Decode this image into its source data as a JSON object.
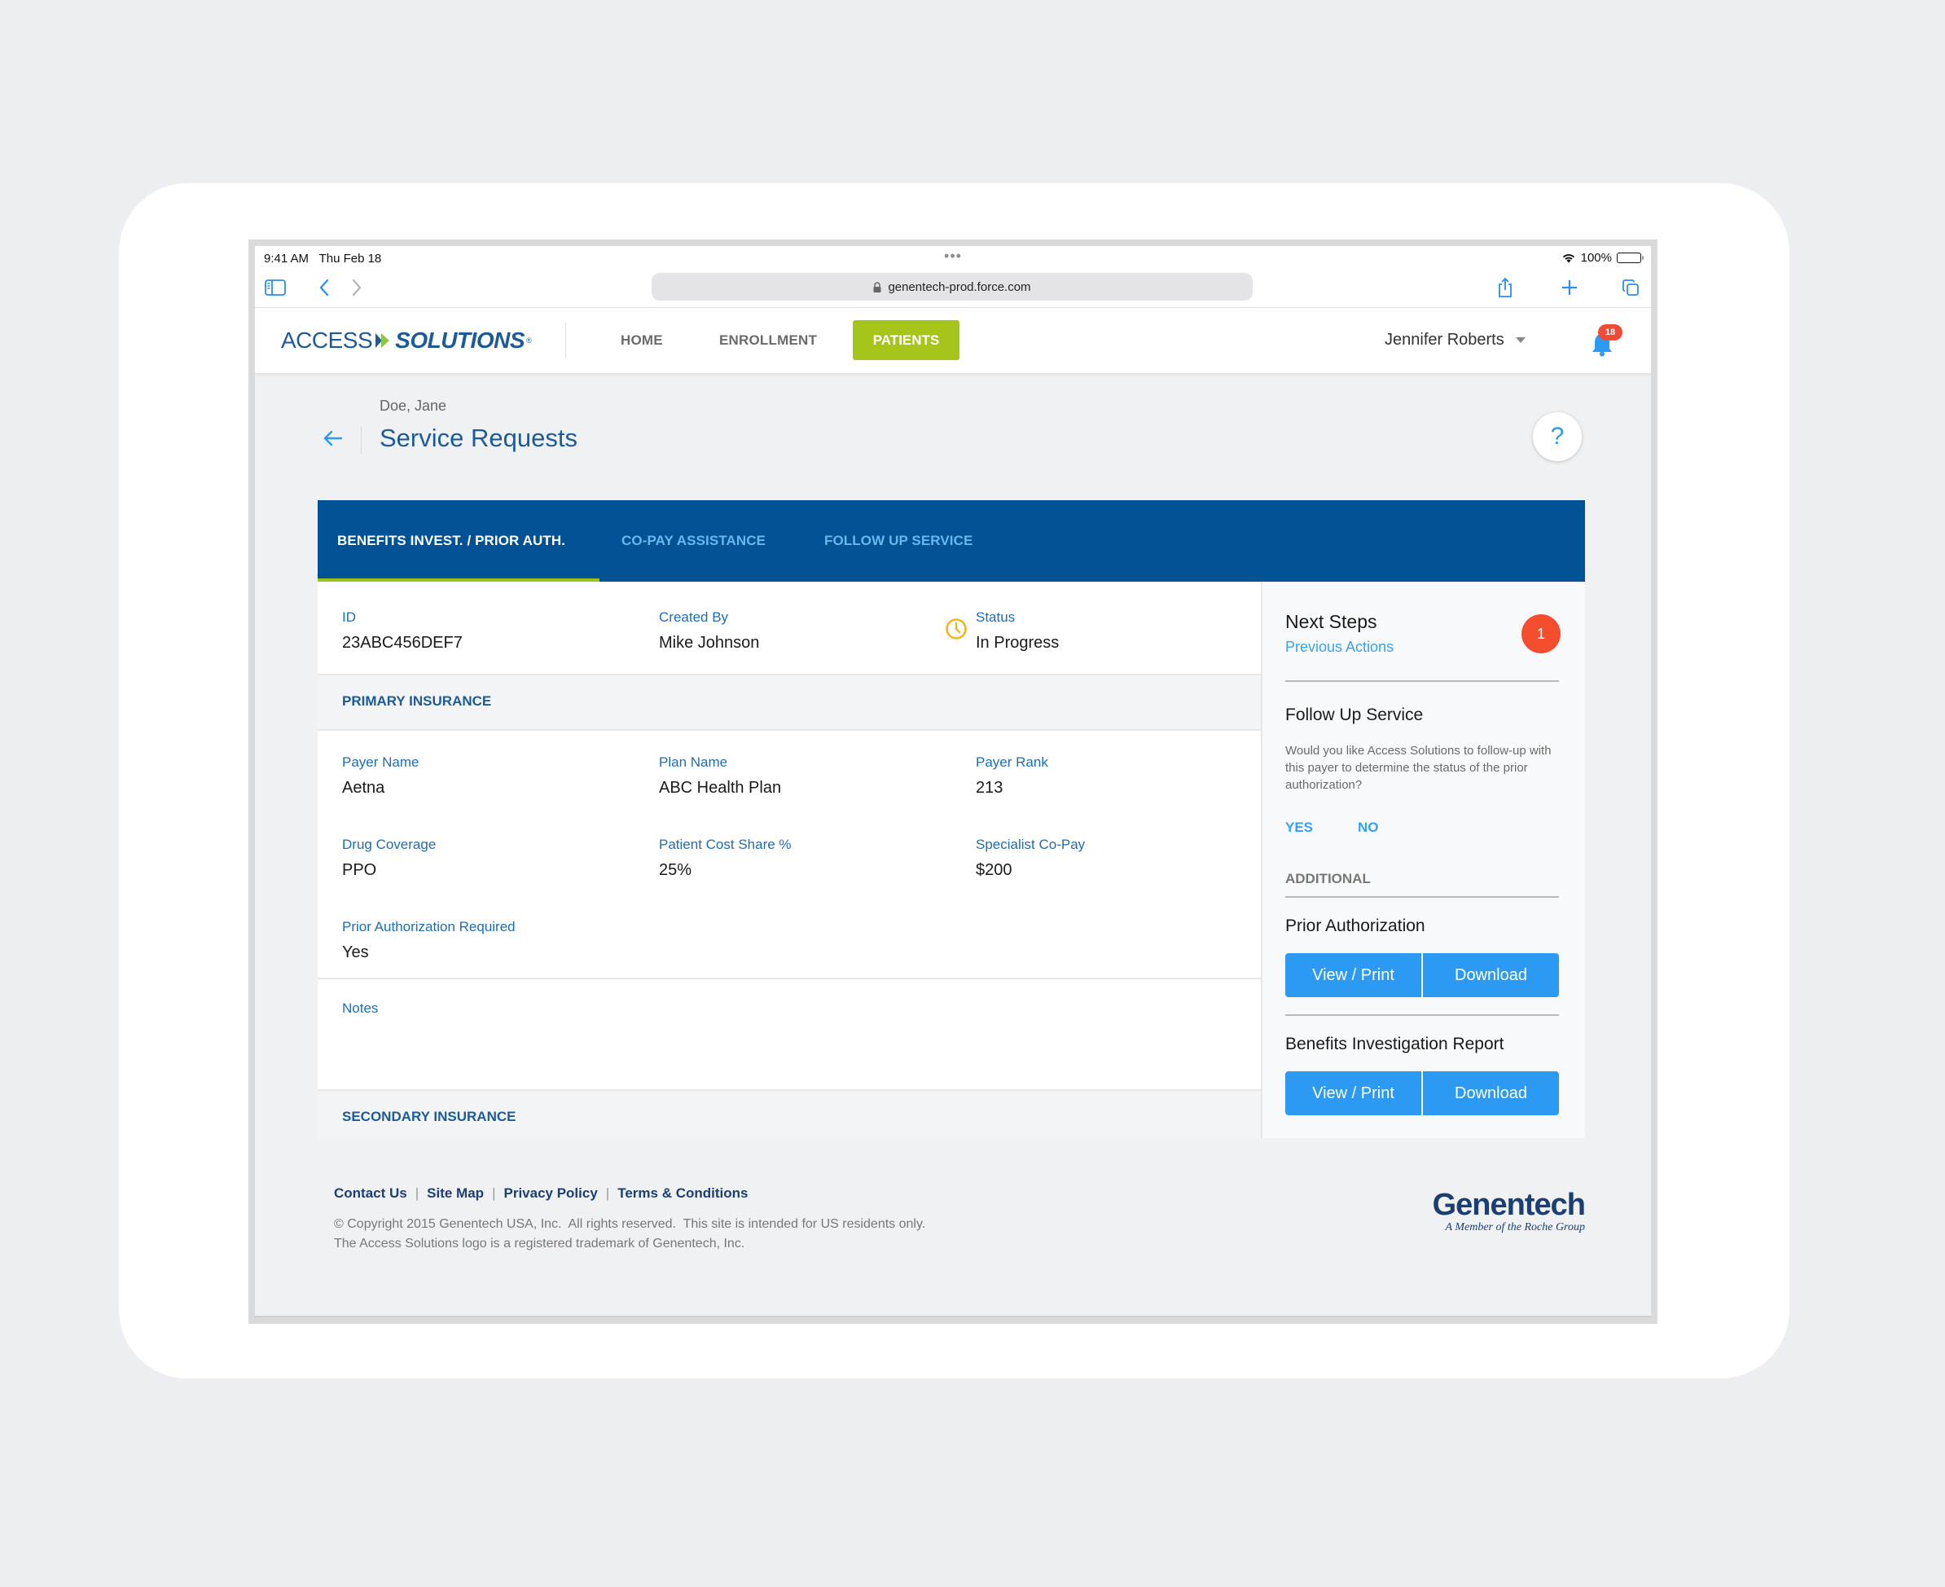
{
  "status_bar": {
    "time": "9:41 AM",
    "date": "Thu Feb 18",
    "battery": "100%"
  },
  "browser": {
    "url": "genentech-prod.force.com",
    "icons": [
      "sidebar-icon",
      "back-icon",
      "forward-icon",
      "lock-icon",
      "share-icon",
      "new-tab-icon",
      "tabs-icon"
    ]
  },
  "nav": {
    "logo_access": "ACCESS",
    "logo_solutions": "SOLUTIONS",
    "logo_reg": "®",
    "items": [
      {
        "label": "HOME"
      },
      {
        "label": "ENROLLMENT"
      },
      {
        "label": "PATIENTS",
        "active": true
      }
    ],
    "user_name": "Jennifer Roberts",
    "notification_count": "18",
    "accent_color": "#A6C51A"
  },
  "page": {
    "patient_name": "Doe, Jane",
    "title": "Service Requests",
    "help_label": "?"
  },
  "tabs": [
    {
      "label": "BENEFITS INVEST. / PRIOR AUTH.",
      "active": true
    },
    {
      "label": "CO-PAY ASSISTANCE",
      "active": false
    },
    {
      "label": "FOLLOW UP SERVICE",
      "active": false
    }
  ],
  "request": {
    "id_label": "ID",
    "id_value": "23ABC456DEF7",
    "created_by_label": "Created By",
    "created_by_value": "Mike Johnson",
    "status_label": "Status",
    "status_value": "In Progress",
    "status_icon": "clock-icon",
    "status_color": "#F2B51C"
  },
  "primary_insurance": {
    "heading": "PRIMARY INSURANCE",
    "fields": [
      {
        "label": "Payer Name",
        "value": "Aetna"
      },
      {
        "label": "Plan Name",
        "value": "ABC Health Plan"
      },
      {
        "label": "Payer Rank",
        "value": "213"
      },
      {
        "label": "Drug Coverage",
        "value": "PPO"
      },
      {
        "label": "Patient Cost Share %",
        "value": "25%"
      },
      {
        "label": "Specialist Co-Pay",
        "value": "$200"
      },
      {
        "label": "Prior Authorization Required",
        "value": "Yes"
      }
    ],
    "notes_label": "Notes",
    "notes_value": ""
  },
  "secondary_insurance": {
    "heading": "SECONDARY INSURANCE"
  },
  "side_panel": {
    "title": "Next Steps",
    "previous_actions": "Previous Actions",
    "count": "1",
    "follow_up_title": "Follow Up Service",
    "follow_up_desc": "Would you like Access Solutions to follow-up with this payer to determine the status of the prior authorization?",
    "yes_label": "YES",
    "no_label": "NO",
    "additional_label": "ADDITIONAL",
    "documents": [
      {
        "title": "Prior Authorization",
        "view_label": "View / Print",
        "download_label": "Download"
      },
      {
        "title": "Benefits Investigation Report",
        "view_label": "View / Print",
        "download_label": "Download"
      }
    ]
  },
  "footer": {
    "links": [
      "Contact Us",
      "Site Map",
      "Privacy Policy",
      "Terms & Conditions"
    ],
    "separator": "|",
    "copyright_line1": "© Copyright 2015 Genentech USA, Inc.  All rights reserved.  This site is intended for US residents only.",
    "copyright_line2": "The Access Solutions logo is a registered trademark of Genentech, Inc.",
    "brand_name": "Genentech",
    "brand_tagline": "A Member of the Roche Group"
  }
}
